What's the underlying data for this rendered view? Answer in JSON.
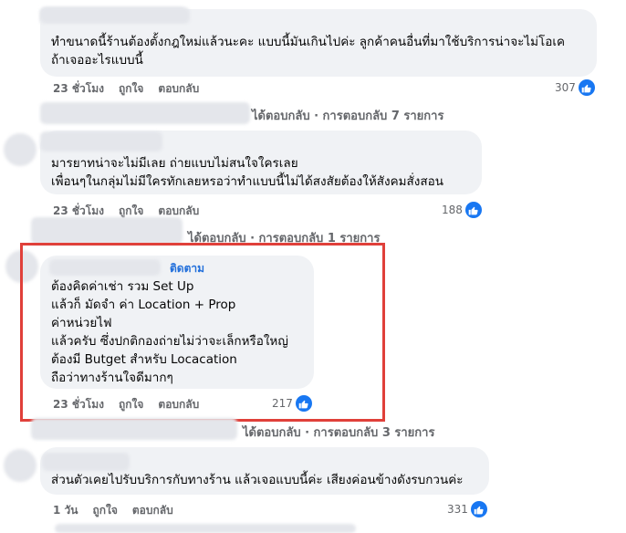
{
  "comments": [
    {
      "lines": [
        "ทำขนาดนี้ร้านต้องตั้งกฎใหม่แล้วนะคะ แบบนี้มันเกินไปค่ะ ลูกค้าคนอื่นที่มาใช้บริการน่าจะไม่โอเค",
        "ถ้าเจออะไรแบบนี้"
      ],
      "time": "23 ชั่วโมง",
      "like": "ถูกใจ",
      "reply": "ตอบกลับ",
      "count": "307"
    },
    {
      "lines": [
        "มารยาทน่าจะไม่มีเลย ถ่ายแบบไม่สนใจใครเลย",
        "เพื่อนๆในกลุ่มไม่มีใครทักเลยหรอว่าทำแบบนี้ไม่ได้สงสัยต้องให้สังคมสั่งสอน"
      ],
      "time": "23 ชั่วโมง",
      "like": "ถูกใจ",
      "reply": "ตอบกลับ",
      "count": "188"
    },
    {
      "follow": "ติดตาม",
      "lines": [
        "ต้องคิดค่าเช่า รวม Set Up",
        "แล้วก็ มัดจำ ค่า Location + Prop",
        "ค่าหน่วยไฟ",
        "แล้วครับ ซึ่งปกติกองถ่ายไม่ว่าจะเล็กหรือใหญ่",
        "ต้องมี Butget สำหรับ Locacation",
        "ถือว่าทางร้านใจดีมากๆ"
      ],
      "time": "23 ชั่วโมง",
      "like": "ถูกใจ",
      "reply": "ตอบกลับ",
      "count": "217"
    },
    {
      "lines": [
        "ส่วนตัวเคยไปรับบริการกับทางร้าน แล้วเจอแบบนี้ค่ะ เสียงค่อนข้างดังรบกวนค่ะ"
      ],
      "time": "1 วัน",
      "like": "ถูกใจ",
      "reply": "ตอบกลับ",
      "count": "331"
    }
  ],
  "reply_threads": [
    "ได้ตอบกลับ · การตอบกลับ 7 รายการ",
    "ได้ตอบกลับ · การตอบกลับ 1 รายการ",
    "ได้ตอบกลับ · การตอบกลับ 3 รายการ"
  ],
  "colors": {
    "like_blue": "#1877f2",
    "highlight_red": "#e0403a",
    "bubble_bg": "#f0f2f5"
  }
}
